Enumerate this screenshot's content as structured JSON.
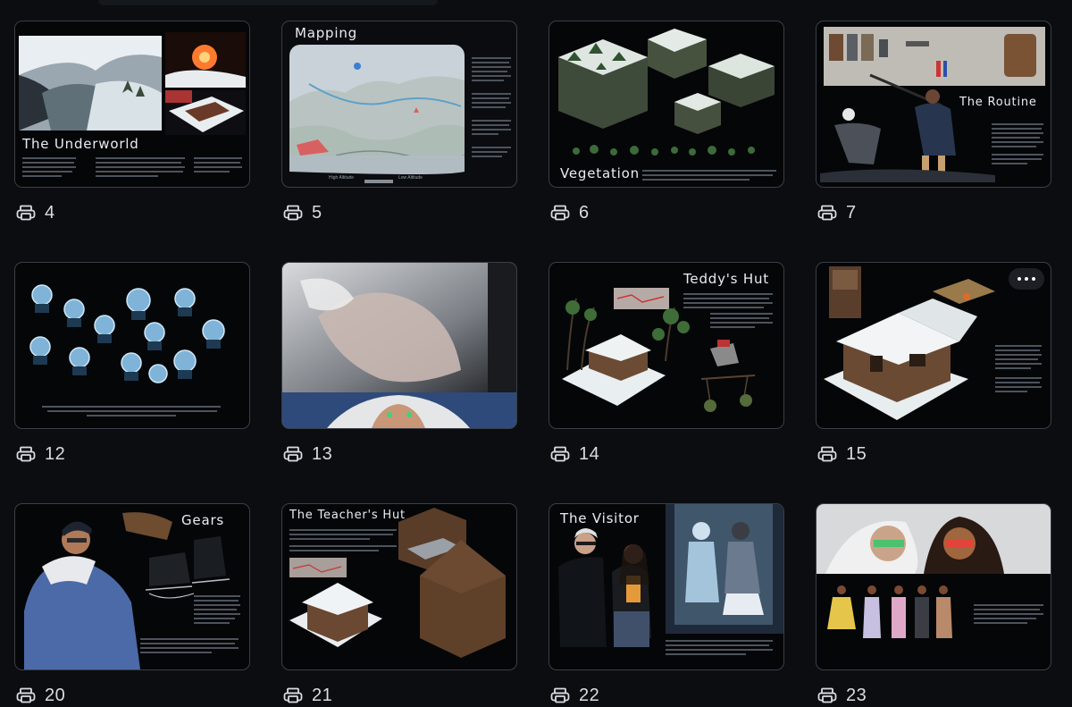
{
  "gallery": {
    "items": [
      {
        "page": "4",
        "title": "The Underworld"
      },
      {
        "page": "5",
        "title": "Mapping",
        "legend_high": "High Altitude",
        "legend_low": "Low Altitude"
      },
      {
        "page": "6",
        "title": "Vegetation"
      },
      {
        "page": "7",
        "title": "The Routine"
      },
      {
        "page": "12",
        "title": ""
      },
      {
        "page": "13",
        "title": ""
      },
      {
        "page": "14",
        "title": "Teddy's Hut"
      },
      {
        "page": "15",
        "title": ""
      },
      {
        "page": "20",
        "title": "Gears"
      },
      {
        "page": "21",
        "title": "The Teacher's Hut"
      },
      {
        "page": "22",
        "title": "The Visitor"
      },
      {
        "page": "23",
        "title": ""
      }
    ]
  },
  "icons": {
    "page_icon": "print-icon",
    "menu_icon": "more-horizontal-icon"
  },
  "colors": {
    "background": "#0b0d10",
    "card_border": "#3a3f47",
    "text": "#d9dde3"
  }
}
